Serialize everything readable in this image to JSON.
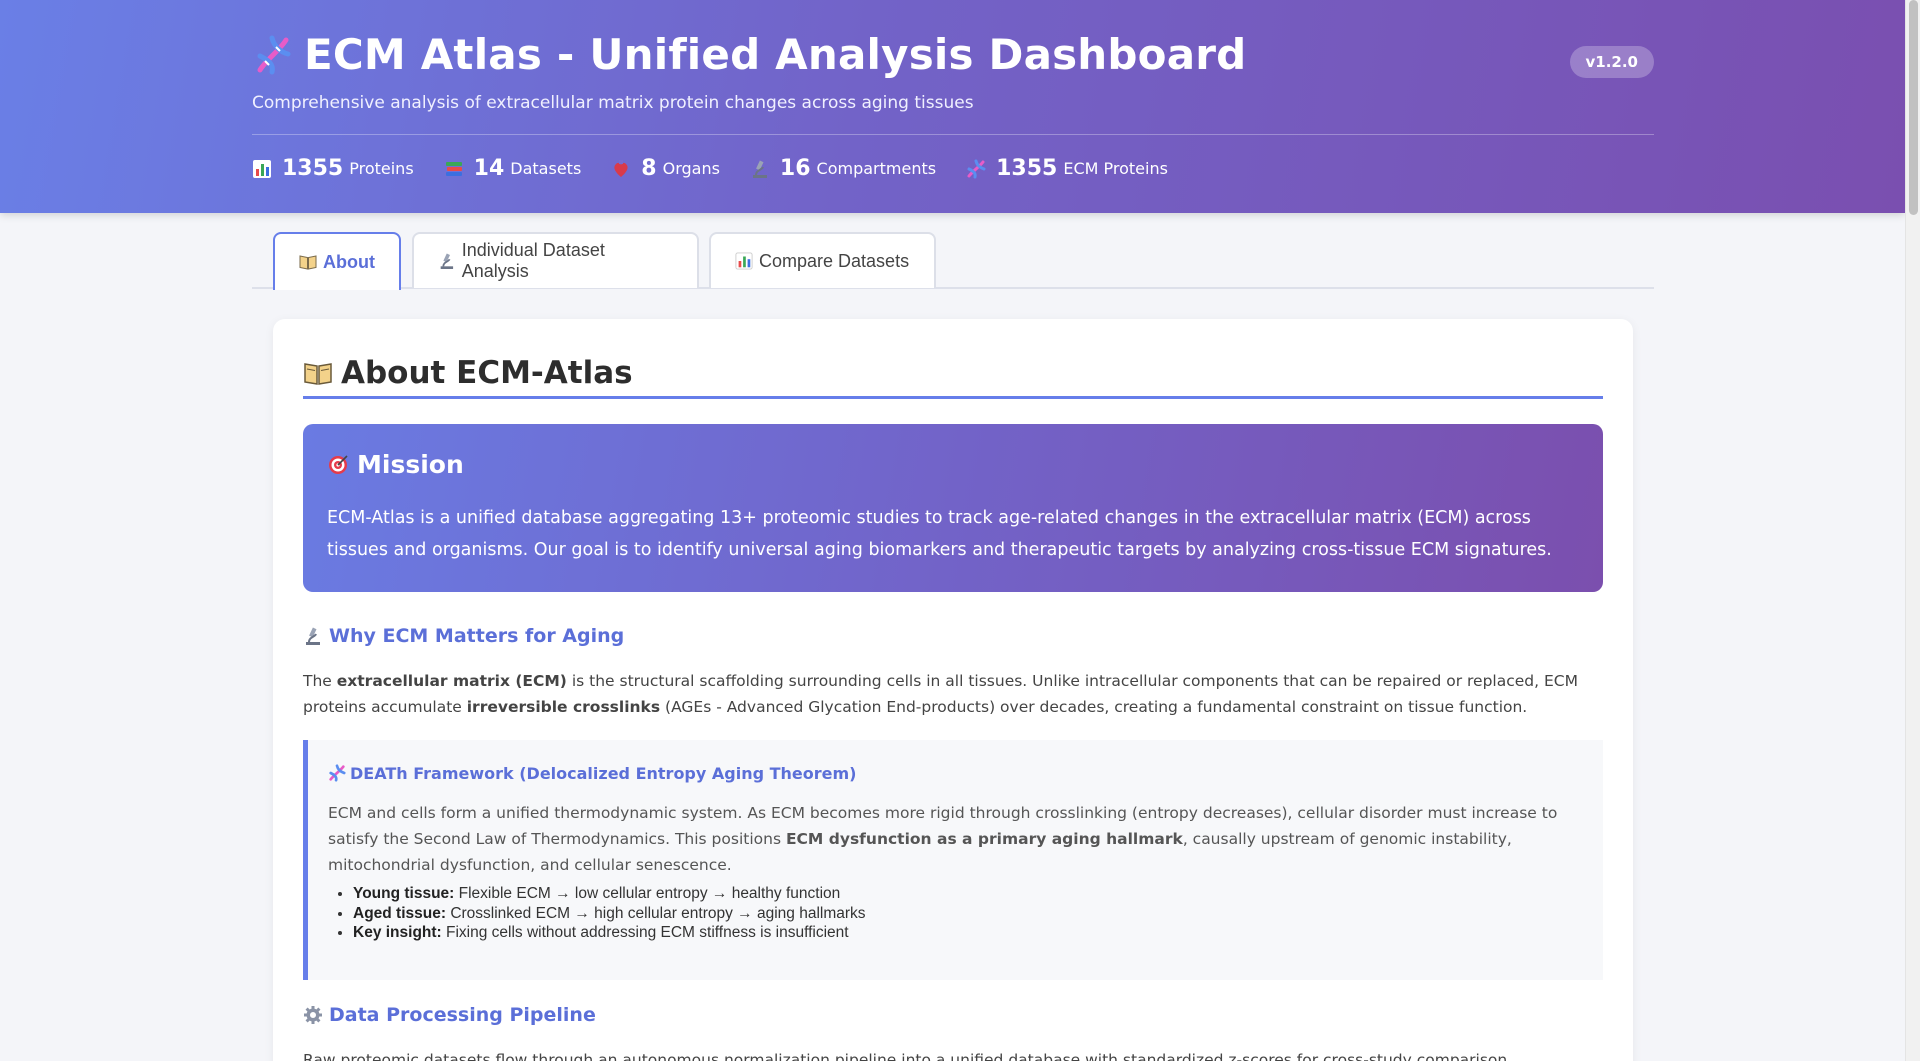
{
  "header": {
    "title": "ECM Atlas - Unified Analysis Dashboard",
    "subtitle": "Comprehensive analysis of extracellular matrix protein changes across aging tissues",
    "version": "v1.2.0",
    "title_icon": "dna-icon",
    "stats": [
      {
        "icon": "bar-chart-icon",
        "value": "1355",
        "label": "Proteins"
      },
      {
        "icon": "books-icon",
        "value": "14",
        "label": "Datasets"
      },
      {
        "icon": "heart-organ-icon",
        "value": "8",
        "label": "Organs"
      },
      {
        "icon": "microscope-icon",
        "value": "16",
        "label": "Compartments"
      },
      {
        "icon": "dna-icon",
        "value": "1355",
        "label": "ECM Proteins"
      }
    ]
  },
  "tabs": [
    {
      "icon": "book-icon",
      "label": "About",
      "active": true
    },
    {
      "icon": "microscope-icon",
      "label": "Individual Dataset Analysis",
      "active": false
    },
    {
      "icon": "bar-chart-icon",
      "label": "Compare Datasets",
      "active": false
    }
  ],
  "about": {
    "title": "About ECM-Atlas",
    "mission": {
      "title": "Mission",
      "text": "ECM-Atlas is a unified database aggregating 13+ proteomic studies to track age-related changes in the extracellular matrix (ECM) across tissues and organisms. Our goal is to identify universal aging biomarkers and therapeutic targets by analyzing cross-tissue ECM signatures."
    },
    "why": {
      "title": "Why ECM Matters for Aging",
      "t1": "The ",
      "b1": "extracellular matrix (ECM)",
      "t2": " is the structural scaffolding surrounding cells in all tissues. Unlike intracellular components that can be repaired or replaced, ECM proteins accumulate ",
      "b2": "irreversible crosslinks",
      "t3": " (AGEs - Advanced Glycation End-products) over decades, creating a fundamental constraint on tissue function."
    },
    "framework": {
      "title": "DEATh Framework (Delocalized Entropy Aging Theorem)",
      "t1": "ECM and cells form a unified thermodynamic system. As ECM becomes more rigid through crosslinking (entropy decreases), cellular disorder must increase to satisfy the Second Law of Thermodynamics. This positions ",
      "b1": "ECM dysfunction as a primary aging hallmark",
      "t2": ", causally upstream of genomic instability, mitochondrial dysfunction, and cellular senescence.",
      "items": [
        {
          "label": "Young tissue:",
          "text": " Flexible ECM → low cellular entropy → healthy function"
        },
        {
          "label": "Aged tissue:",
          "text": " Crosslinked ECM → high cellular entropy → aging hallmarks"
        },
        {
          "label": "Key insight:",
          "text": " Fixing cells without addressing ECM stiffness is insufficient"
        }
      ]
    },
    "pipeline": {
      "title": "Data Processing Pipeline",
      "text": "Raw proteomic datasets flow through an autonomous normalization pipeline into a unified database with standardized z-scores for cross-study comparison."
    }
  },
  "colors": {
    "accent": "#667eea",
    "gradient_start": "#6a7fe6",
    "gradient_end": "#7a4fb0"
  }
}
